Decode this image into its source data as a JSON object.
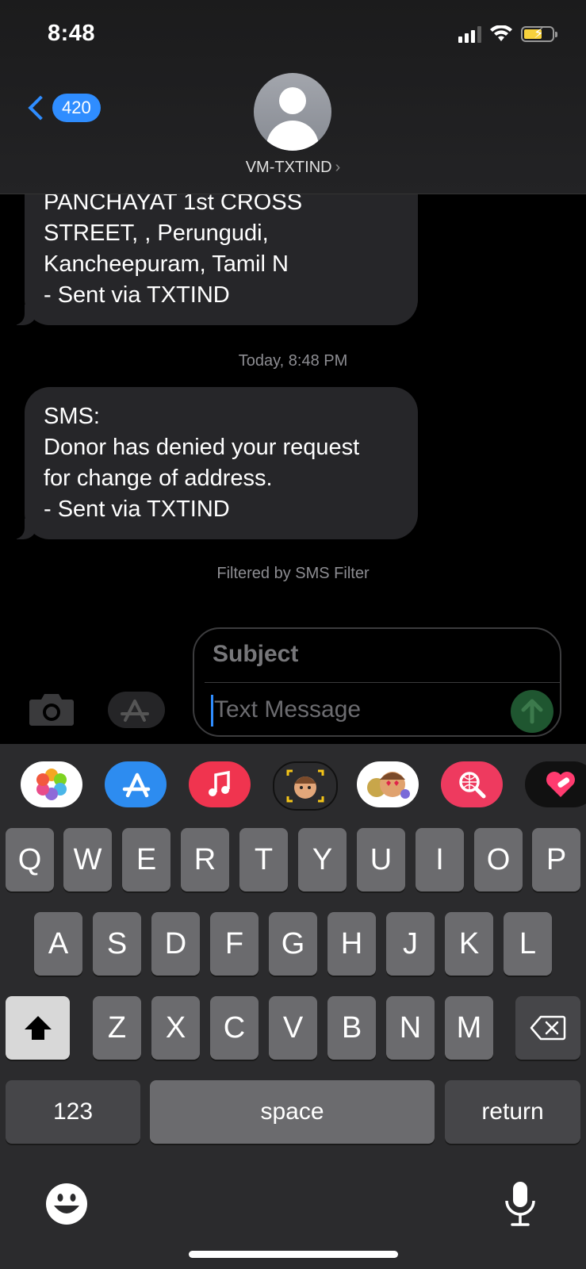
{
  "status_bar": {
    "time": "8:48"
  },
  "header": {
    "back_badge": "420",
    "contact_name": "VM-TXTIND",
    "contact_chevron": "›"
  },
  "messages": [
    {
      "text": "PANCHAYAT 1st CROSS\nSTREET, , Perungudi,\nKancheepuram, Tamil N\n- Sent via TXTIND"
    },
    {
      "text": "SMS:\nDonor has denied your request\nfor change of address.\n- Sent via TXTIND"
    }
  ],
  "timestamp": {
    "day": "Today,",
    "time": "8:48 PM"
  },
  "filter_note": "Filtered by SMS Filter",
  "compose": {
    "subject_placeholder": "Subject",
    "message_placeholder": "Text Message"
  },
  "app_strip": [
    {
      "icon": "photos-icon",
      "color": "#ffffff"
    },
    {
      "icon": "app-store-icon",
      "color": "#2d8cf0"
    },
    {
      "icon": "music-icon",
      "color": "#f0344f"
    },
    {
      "icon": "memoji-camera-icon",
      "color": "#2b2b2d"
    },
    {
      "icon": "memoji-stickers-icon",
      "color": "#ffffff"
    },
    {
      "icon": "web-search-icon",
      "color": "#ee3a5f"
    },
    {
      "icon": "heart-sticker-icon",
      "color": "#111111"
    }
  ],
  "keyboard": {
    "row1": [
      "Q",
      "W",
      "E",
      "R",
      "T",
      "Y",
      "U",
      "I",
      "O",
      "P"
    ],
    "row2": [
      "A",
      "S",
      "D",
      "F",
      "G",
      "H",
      "J",
      "K",
      "L"
    ],
    "row3": [
      "Z",
      "X",
      "C",
      "V",
      "B",
      "N",
      "M"
    ],
    "numbers_key": "123",
    "space_key": "space",
    "return_key": "return"
  },
  "colors": {
    "accent": "#2f8dff",
    "bubble": "#262629",
    "key": "#6b6b6e",
    "send": "#1f5630"
  }
}
